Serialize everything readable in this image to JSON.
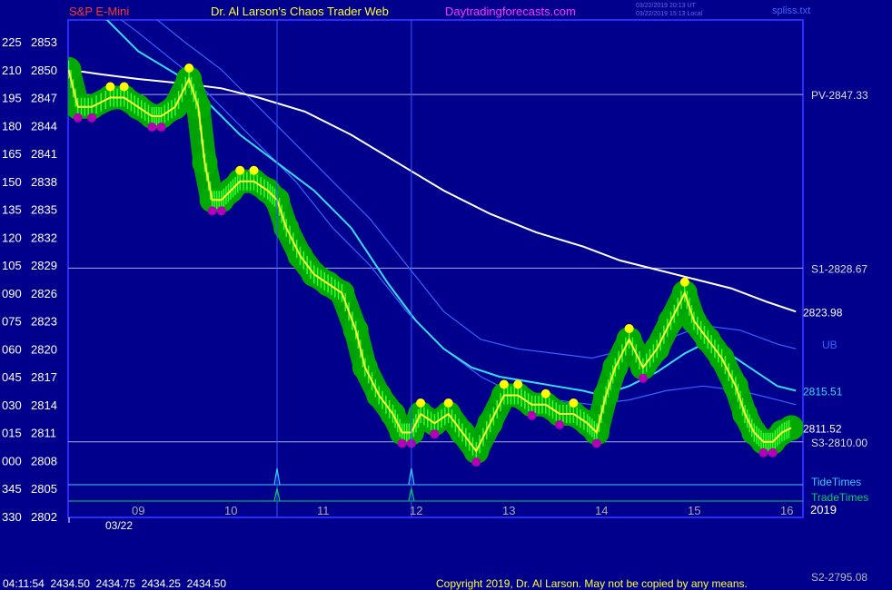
{
  "header": {
    "symbol": "S&P E-Mini",
    "site": "Dr. Al Larson's Chaos Trader Web",
    "url": "Daytradingforecasts.com",
    "time_utc": "03/22/2019 20:13 UT",
    "time_local": "03/22/2019 15:13 Local",
    "file": "spliss.txt"
  },
  "footer": {
    "quote": "04:11:54  2434.50  2434.75  2434.25  2434.50",
    "copyright": "Copyright 2019, Dr. Al Larson. May not be copied by any means."
  },
  "colors": {
    "background": "#00008c",
    "frame": "#2a2aff",
    "green_band": "#00aa00",
    "price": "#ffff33",
    "price_low_dot": "#b400b4",
    "price_high_dot": "#ffff00",
    "pivot_line": "#ffffff",
    "cyan_line": "#33ddff",
    "blue_lines": "#3366ff",
    "tide": "#33ccff",
    "trade": "#00cc66"
  },
  "chart_data": {
    "type": "line",
    "title": "S&P E-Mini",
    "y_ticks": [
      {
        "angle": "225",
        "price": "2853"
      },
      {
        "angle": "210",
        "price": "2850"
      },
      {
        "angle": "195",
        "price": "2847"
      },
      {
        "angle": "180",
        "price": "2844"
      },
      {
        "angle": "165",
        "price": "2841"
      },
      {
        "angle": "150",
        "price": "2838"
      },
      {
        "angle": "135",
        "price": "2835"
      },
      {
        "angle": "120",
        "price": "2832"
      },
      {
        "angle": "105",
        "price": "2829"
      },
      {
        "angle": "090",
        "price": "2826"
      },
      {
        "angle": "075",
        "price": "2823"
      },
      {
        "angle": "060",
        "price": "2820"
      },
      {
        "angle": "045",
        "price": "2817"
      },
      {
        "angle": "030",
        "price": "2814"
      },
      {
        "angle": "015",
        "price": "2811"
      },
      {
        "angle": "000",
        "price": "2808"
      },
      {
        "angle": "345",
        "price": "2805"
      },
      {
        "angle": "330",
        "price": "2802"
      }
    ],
    "x_ticks": [
      "09",
      "10",
      "11",
      "12",
      "13",
      "14",
      "15",
      "16"
    ],
    "x_date": "03/22",
    "x_year": "2019",
    "ylim": [
      2802,
      2855.5
    ],
    "xlim": [
      8.25,
      16.1
    ],
    "levels": [
      {
        "label": "PV-2847.33",
        "value": 2847.33
      },
      {
        "label": "S1-2828.67",
        "value": 2828.67
      },
      {
        "label": "S3-2810.00",
        "value": 2810.0
      }
    ],
    "offscale_label": "S2-2795.08",
    "end_labels": {
      "white": "2823.98",
      "cyan": "2815.51",
      "price": "2811.52",
      "blue": "UB"
    },
    "time_markers": [
      10.5,
      11.95
    ],
    "marker_legend": {
      "tide": "TideTimes",
      "trade": "TradeTimes"
    },
    "series": [
      {
        "id": "price",
        "x": [
          8.25,
          8.35,
          8.5,
          8.7,
          8.85,
          9.0,
          9.15,
          9.25,
          9.4,
          9.55,
          9.65,
          9.72,
          9.8,
          9.9,
          10.0,
          10.1,
          10.25,
          10.4,
          10.5,
          10.6,
          10.75,
          10.9,
          11.05,
          11.2,
          11.35,
          11.45,
          11.6,
          11.75,
          11.85,
          11.95,
          12.05,
          12.2,
          12.35,
          12.5,
          12.65,
          12.8,
          12.95,
          13.1,
          13.25,
          13.4,
          13.55,
          13.7,
          13.85,
          13.95,
          14.05,
          14.15,
          14.3,
          14.45,
          14.6,
          14.75,
          14.9,
          15.0,
          15.15,
          15.3,
          15.45,
          15.55,
          15.65,
          15.75,
          15.85,
          15.95,
          16.05
        ],
        "y": [
          2850,
          2846,
          2846,
          2847,
          2847,
          2846,
          2845,
          2845,
          2846,
          2849,
          2846,
          2840,
          2836,
          2836,
          2837,
          2838,
          2838,
          2837,
          2836,
          2833,
          2830,
          2828,
          2827,
          2826,
          2822,
          2818,
          2815,
          2813,
          2811,
          2811,
          2813,
          2812,
          2813,
          2811,
          2809,
          2812,
          2815,
          2815,
          2814,
          2814,
          2813,
          2813,
          2812,
          2811,
          2815,
          2818,
          2821,
          2818,
          2820,
          2823,
          2826,
          2823,
          2821,
          2819,
          2816,
          2813,
          2811,
          2810,
          2810,
          2811,
          2811.5
        ]
      },
      {
        "id": "white",
        "x": [
          8.25,
          8.6,
          9.0,
          9.5,
          9.9,
          10.3,
          10.8,
          11.3,
          11.8,
          12.3,
          12.8,
          13.3,
          13.8,
          14.2,
          14.6,
          15.0,
          15.4,
          15.8,
          16.1
        ],
        "y": [
          2850,
          2849.5,
          2849,
          2848.5,
          2848,
          2847,
          2845.5,
          2843,
          2840,
          2837,
          2834.5,
          2832.5,
          2831,
          2829.5,
          2828.5,
          2827.5,
          2826.5,
          2825,
          2824
        ]
      },
      {
        "id": "cyan",
        "x": [
          8.25,
          8.6,
          9.0,
          9.5,
          9.8,
          10.1,
          10.5,
          10.9,
          11.3,
          11.7,
          12.0,
          12.3,
          12.6,
          12.9,
          13.2,
          13.5,
          13.8,
          14.0,
          14.3,
          14.6,
          14.9,
          15.1,
          15.3,
          15.6,
          15.9,
          16.1
        ],
        "y": [
          2862,
          2856,
          2852,
          2849,
          2846,
          2843,
          2840,
          2837,
          2833,
          2827,
          2823,
          2820,
          2818,
          2817,
          2816.5,
          2816,
          2815.5,
          2815,
          2816,
          2817.5,
          2819.5,
          2820.5,
          2820,
          2818,
          2816,
          2815.5
        ]
      },
      {
        "id": "blue1",
        "x": [
          8.25,
          8.6,
          9.0,
          9.5,
          9.9,
          10.3,
          10.7,
          11.1,
          11.5,
          11.9,
          12.3,
          12.7,
          13.1,
          13.5,
          13.9,
          14.3,
          14.7,
          15.1,
          15.5,
          15.9,
          16.1
        ],
        "y": [
          2862,
          2860,
          2857,
          2853,
          2850,
          2846,
          2842,
          2838,
          2834,
          2829,
          2824,
          2821,
          2820,
          2819.5,
          2819,
          2820,
          2821,
          2822.5,
          2822,
          2820.5,
          2820
        ]
      },
      {
        "id": "blue2",
        "x": [
          8.25,
          8.6,
          9.0,
          9.5,
          9.9,
          10.3,
          10.7,
          11.1,
          11.5,
          11.9,
          12.3,
          12.7,
          13.1,
          13.5,
          13.9,
          14.3,
          14.7,
          15.1,
          15.5,
          15.9,
          16.1
        ],
        "y": [
          2860,
          2857,
          2854,
          2850,
          2846,
          2842,
          2838,
          2833,
          2829,
          2824,
          2820,
          2817,
          2815,
          2814.5,
          2814,
          2814.5,
          2815.5,
          2816,
          2815.5,
          2814.5,
          2814
        ]
      }
    ]
  }
}
